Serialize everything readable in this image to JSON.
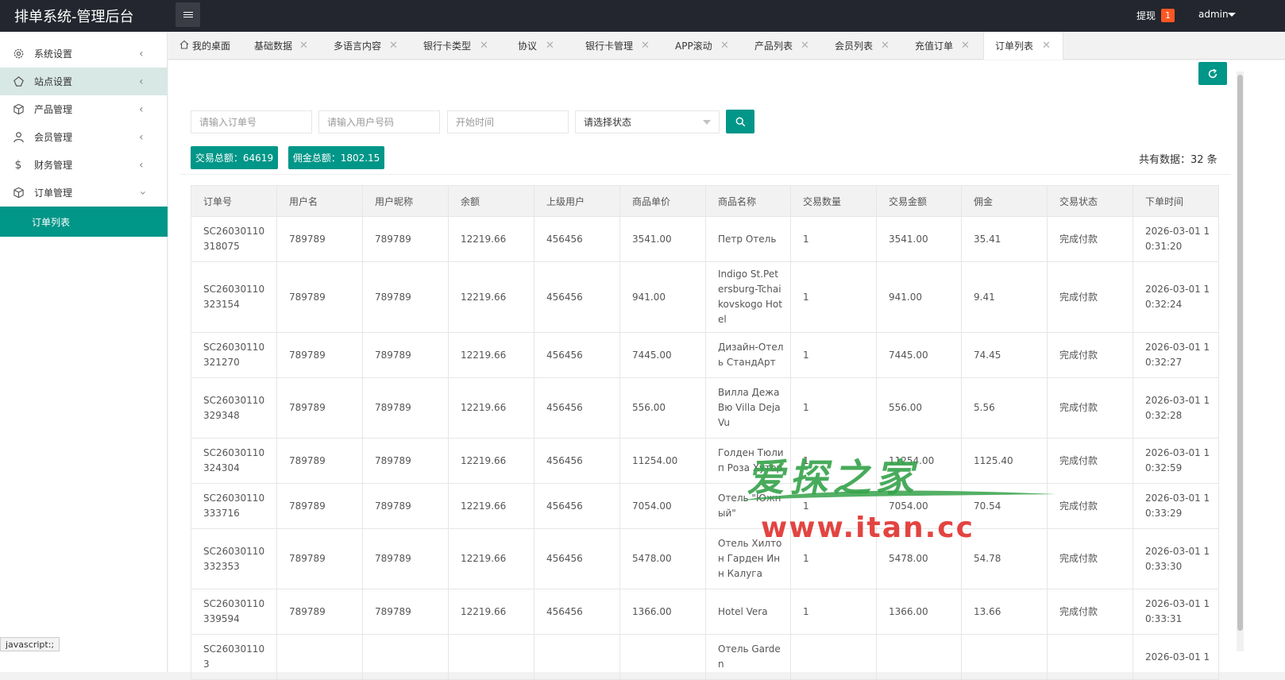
{
  "header": {
    "title": "排单系统-管理后台",
    "withdraw_label": "提现",
    "withdraw_count": "1",
    "user": "admin"
  },
  "sidebar": {
    "items": [
      {
        "label": "系统设置"
      },
      {
        "label": "站点设置"
      },
      {
        "label": "产品管理"
      },
      {
        "label": "会员管理"
      },
      {
        "label": "财务管理"
      },
      {
        "label": "订单管理"
      }
    ],
    "active_sub": "订单列表"
  },
  "tabs": [
    "我的桌面",
    "基础数据",
    "多语言内容",
    "银行卡类型",
    "协议",
    "银行卡管理",
    "APP滚动",
    "产品列表",
    "会员列表",
    "充值订单",
    "订单列表"
  ],
  "filters": {
    "order_no_placeholder": "请输入订单号",
    "user_no_placeholder": "请输入用户号码",
    "start_time_placeholder": "开始时间",
    "status_select": "请选择状态"
  },
  "stats": {
    "trade_total": "交易总额：64619",
    "commission_total": "佣金总额：1802.15",
    "record_count": "共有数据：32 条"
  },
  "table": {
    "headers": [
      "订单号",
      "用户名",
      "用户昵称",
      "余额",
      "上级用户",
      "商品单价",
      "商品名称",
      "交易数量",
      "交易金额",
      "佣金",
      "交易状态",
      "下单时间"
    ],
    "rows": [
      [
        "SC26030110318075",
        "789789",
        "789789",
        "12219.66",
        "456456",
        "3541.00",
        "Петр Отель",
        "1",
        "3541.00",
        "35.41",
        "完成付款",
        "2026-03-01 10:31:20"
      ],
      [
        "SC26030110323154",
        "789789",
        "789789",
        "12219.66",
        "456456",
        "941.00",
        "Indigo St.Petersburg-Tchaikovskogo Hotel",
        "1",
        "941.00",
        "9.41",
        "完成付款",
        "2026-03-01 10:32:24"
      ],
      [
        "SC26030110321270",
        "789789",
        "789789",
        "12219.66",
        "456456",
        "7445.00",
        "Дизайн-Отель СтандАрт",
        "1",
        "7445.00",
        "74.45",
        "完成付款",
        "2026-03-01 10:32:27"
      ],
      [
        "SC26030110329348",
        "789789",
        "789789",
        "12219.66",
        "456456",
        "556.00",
        "Вилла Дежа Вю Villa Deja Vu",
        "1",
        "556.00",
        "5.56",
        "完成付款",
        "2026-03-01 10:32:28"
      ],
      [
        "SC26030110324304",
        "789789",
        "789789",
        "12219.66",
        "456456",
        "11254.00",
        "Голден Тюлип Роза Хутор",
        "1",
        "11254.00",
        "1125.40",
        "完成付款",
        "2026-03-01 10:32:59"
      ],
      [
        "SC26030110333716",
        "789789",
        "789789",
        "12219.66",
        "456456",
        "7054.00",
        "Отель \"Южный\"",
        "1",
        "7054.00",
        "70.54",
        "完成付款",
        "2026-03-01 10:33:29"
      ],
      [
        "SC26030110332353",
        "789789",
        "789789",
        "12219.66",
        "456456",
        "5478.00",
        "Отель Хилтон Гарден Инн Калуга",
        "1",
        "5478.00",
        "54.78",
        "完成付款",
        "2026-03-01 10:33:30"
      ],
      [
        "SC26030110339594",
        "789789",
        "789789",
        "12219.66",
        "456456",
        "1366.00",
        "Hotel Vera",
        "1",
        "1366.00",
        "13.66",
        "完成付款",
        "2026-03-01 10:33:31"
      ],
      [
        "SC260301103",
        "",
        "",
        "",
        "",
        "",
        "Отель Garden",
        "",
        "",
        "",
        "",
        "2026-03-01 1"
      ]
    ]
  },
  "statusbar": "javascript:;",
  "watermark": {
    "title": "爱探之家",
    "url": "www.itan.cc"
  }
}
